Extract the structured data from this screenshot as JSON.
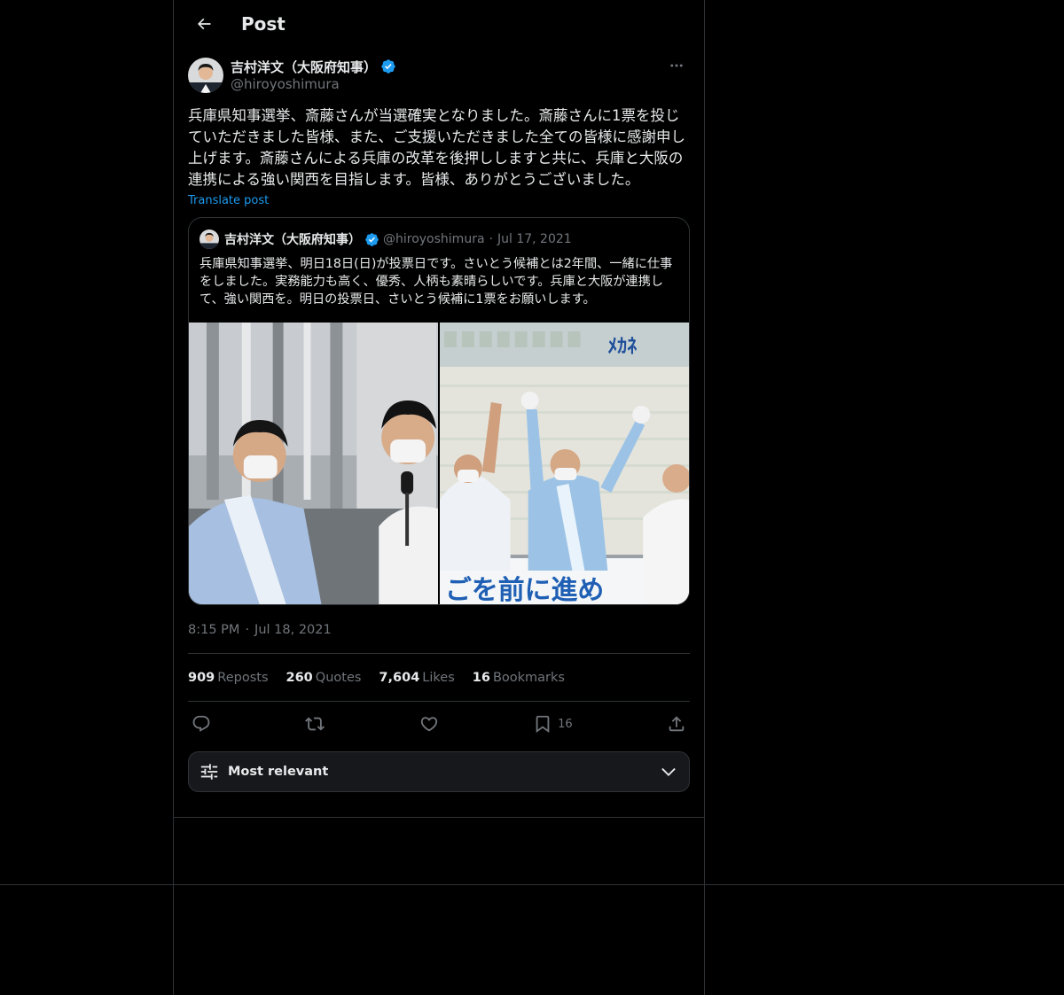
{
  "header": {
    "title": "Post"
  },
  "post": {
    "author": {
      "display_name": "吉村洋文（大阪府知事）",
      "handle": "@hiroyoshimura",
      "verified": true
    },
    "text": "兵庫県知事選挙、斎藤さんが当選確実となりました。斎藤さんに1票を投じていただきました皆様、また、ご支援いただきました全ての皆様に感謝申し上げます。斎藤さんによる兵庫の改革を後押ししますと共に、兵庫と大阪の連携による強い関西を目指します。皆様、ありがとうございました。",
    "translate_label": "Translate post",
    "quoted": {
      "display_name": "吉村洋文（大阪府知事）",
      "handle": "@hiroyoshimura",
      "separator": "·",
      "date": "Jul 17, 2021",
      "text": "兵庫県知事選挙、明日18日(日)が投票日です。さいとう候補とは2年間、一緒に仕事をしました。実務能力も高く、優秀、人柄も素晴らしいです。兵庫と大阪が連携して、強い関西を。明日の投票日、さいとう候補に1票をお願いします。"
    },
    "time": "8:15 PM",
    "time_separator": "·",
    "date": "Jul 18, 2021",
    "stats": {
      "reposts_count": "909",
      "reposts_label": "Reposts",
      "quotes_count": "260",
      "quotes_label": "Quotes",
      "likes_count": "7,604",
      "likes_label": "Likes",
      "bookmarks_count": "16",
      "bookmarks_label": "Bookmarks"
    },
    "actions": {
      "bookmark_count": "16"
    }
  },
  "replies_sort": {
    "label": "Most relevant"
  },
  "icons": {
    "back": "arrow-left-icon",
    "more": "more-horizontal-icon",
    "verified": "verified-badge-icon",
    "reply": "reply-icon",
    "repost": "repost-icon",
    "like": "heart-icon",
    "bookmark": "bookmark-icon",
    "share": "share-icon",
    "sort": "sliders-icon",
    "chevron": "chevron-down-icon"
  },
  "colors": {
    "background": "#000000",
    "text_primary": "#e7e9ea",
    "text_secondary": "#71767b",
    "accent": "#1d9bf0",
    "border": "#2f3336"
  }
}
